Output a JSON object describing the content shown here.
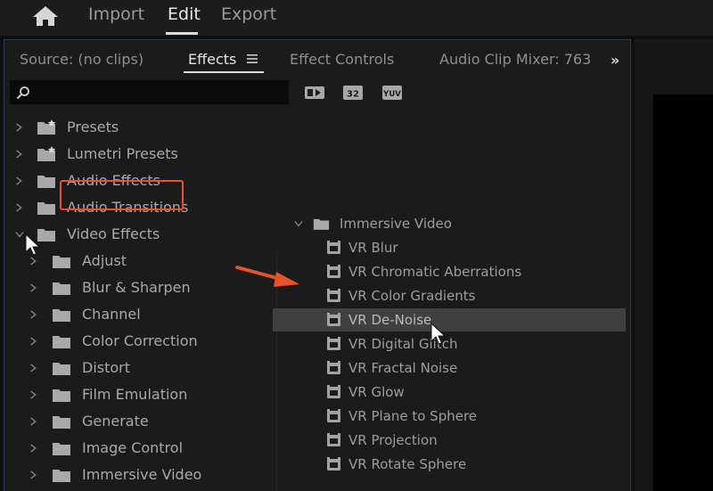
{
  "workspace": {
    "tabs": [
      "Import",
      "Edit",
      "Export"
    ],
    "active": "Edit"
  },
  "panel": {
    "tabs": {
      "source": "Source: (no clips)",
      "effects": "Effects",
      "effect_controls": "Effect Controls",
      "audio_mixer": "Audio Clip Mixer: 763"
    },
    "overflow": "»",
    "search_value": "",
    "filters": [
      "accelerated-effects-icon",
      "32-bit-icon",
      "yuv-icon"
    ],
    "filter_labels": {
      "b2": "32",
      "b3": "YUV"
    }
  },
  "tree": {
    "top": [
      "Presets",
      "Lumetri Presets",
      "Audio Effects",
      "Audio Transitions",
      "Video Effects"
    ],
    "video_effects": [
      "Adjust",
      "Blur & Sharpen",
      "Channel",
      "Color Correction",
      "Distort",
      "Film Emulation",
      "Generate",
      "Image Control",
      "Immersive Video"
    ]
  },
  "immersive": {
    "folder": "Immersive Video",
    "items": [
      "VR Blur",
      "VR Chromatic Aberrations",
      "VR Color Gradients",
      "VR De-Noise",
      "VR Digital Glitch",
      "VR Fractal Noise",
      "VR Glow",
      "VR Plane to Sphere",
      "VR Projection",
      "VR Rotate Sphere"
    ],
    "selected": "VR De-Noise"
  },
  "colors": {
    "accent": "#e4532a",
    "panel_border": "#2e3a57"
  }
}
